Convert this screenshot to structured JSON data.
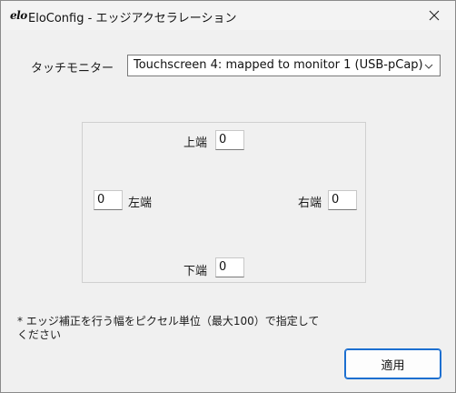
{
  "window": {
    "logo_text": "elo",
    "title": "EloConfig - エッジアクセラレーション"
  },
  "monitor": {
    "label": "タッチモニター",
    "selected": "Touchscreen 4: mapped to monitor 1 (USB-pCap)"
  },
  "edges": {
    "top": {
      "label": "上端",
      "value": "0"
    },
    "left": {
      "label": "左端",
      "value": "0"
    },
    "right": {
      "label": "右端",
      "value": "0"
    },
    "bottom": {
      "label": "下端",
      "value": "0"
    }
  },
  "note": {
    "line1": "* エッジ補正を行う幅をピクセル単位（最大100）で指定して",
    "line2": "ください"
  },
  "buttons": {
    "apply": "適用"
  }
}
